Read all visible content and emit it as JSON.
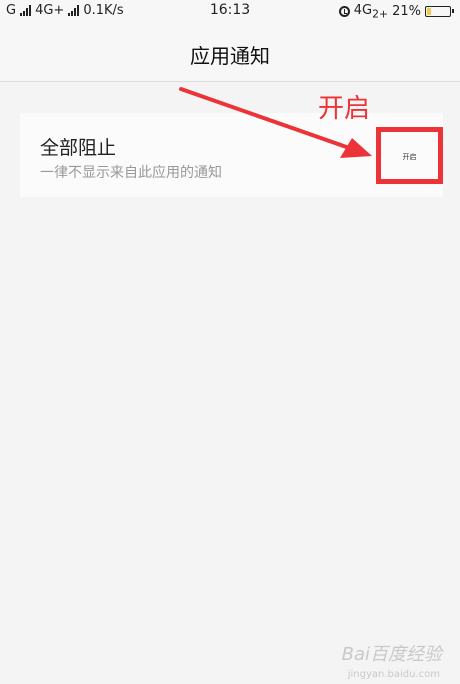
{
  "status_bar": {
    "carrier_left": "G",
    "network_left": "4G+",
    "speed": "0.1K/s",
    "time": "16:13",
    "network_right": "4G",
    "network_right_suffix": "2+",
    "battery_text": "21%",
    "battery_level": 0.21
  },
  "header": {
    "title": "应用通知"
  },
  "setting": {
    "title": "全部阻止",
    "description": "一律不显示来自此应用的通知",
    "toggle_label": "开启"
  },
  "annotation": {
    "label": "开启"
  },
  "watermark": {
    "text": "Bai百度经验",
    "sub": "jingyan.baidu.com"
  },
  "colors": {
    "annotation_red": "#ec3338",
    "battery_yellow": "#f2c94c"
  }
}
